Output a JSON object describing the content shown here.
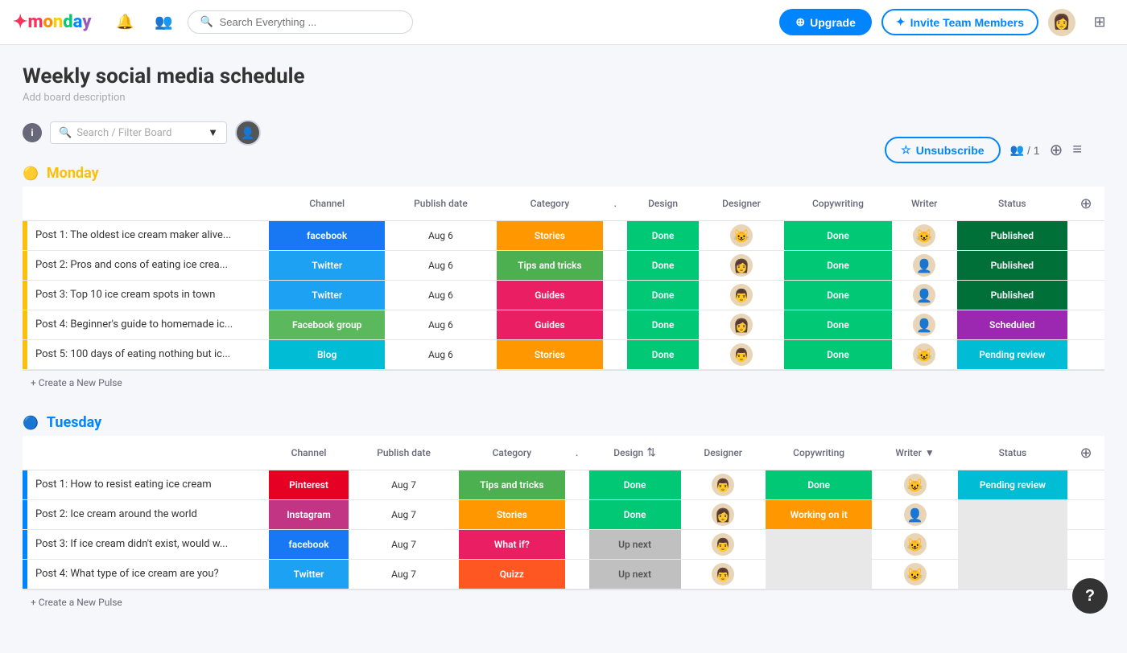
{
  "app": {
    "logo": "monday",
    "nav": {
      "search_placeholder": "Search Everything ...",
      "upgrade_label": "Upgrade",
      "invite_label": "Invite Team Members"
    }
  },
  "page": {
    "title": "Weekly social media schedule",
    "subtitle": "Add board description",
    "unsubscribe_label": "Unsubscribe",
    "members_count": "/ 1"
  },
  "toolbar": {
    "search_placeholder": "Search / Filter Board",
    "create_pulse_label": "+ Create a New Pulse"
  },
  "monday": {
    "day_label": "Monday",
    "columns": {
      "channel": "Channel",
      "publish_date": "Publish date",
      "category": "Category",
      "design": "Design",
      "designer": "Designer",
      "copywriting": "Copywriting",
      "writer": "Writer",
      "status": "Status"
    },
    "rows": [
      {
        "name": "Post 1: The oldest ice cream maker alive...",
        "channel": "facebook",
        "channel_label": "facebook",
        "publish_date": "Aug 6",
        "category": "Stories",
        "design": "Done",
        "copywriting": "Done",
        "status": "Published",
        "avatar_design": "😺",
        "avatar_writer": "😺"
      },
      {
        "name": "Post 2: Pros and cons of eating ice crea...",
        "channel": "twitter",
        "channel_label": "Twitter",
        "publish_date": "Aug 6",
        "category": "Tips and tricks",
        "design": "Done",
        "copywriting": "Done",
        "status": "Published",
        "avatar_design": "👩",
        "avatar_writer": "👤"
      },
      {
        "name": "Post 3: Top 10 ice cream spots in town",
        "channel": "twitter",
        "channel_label": "Twitter",
        "publish_date": "Aug 6",
        "category": "Guides",
        "design": "Done",
        "copywriting": "Done",
        "status": "Published",
        "avatar_design": "👨",
        "avatar_writer": "👤"
      },
      {
        "name": "Post 4: Beginner's guide to homemade ic...",
        "channel": "fbgroup",
        "channel_label": "Facebook group",
        "publish_date": "Aug 6",
        "category": "Guides",
        "design": "Done",
        "copywriting": "Done",
        "status": "Scheduled",
        "avatar_design": "👩",
        "avatar_writer": "👤"
      },
      {
        "name": "Post 5: 100 days of eating nothing but ic...",
        "channel": "blog",
        "channel_label": "Blog",
        "publish_date": "Aug 6",
        "category": "Stories",
        "design": "Done",
        "copywriting": "Done",
        "status": "Pending review",
        "avatar_design": "👨",
        "avatar_writer": "😺"
      }
    ],
    "create_pulse": "+ Create a New Pulse"
  },
  "tuesday": {
    "day_label": "Tuesday",
    "columns": {
      "channel": "Channel",
      "publish_date": "Publish date",
      "category": "Category",
      "design": "Design",
      "designer": "Designer",
      "copywriting": "Copywriting",
      "writer": "Writer",
      "status": "Status"
    },
    "rows": [
      {
        "name": "Post 1: How to resist eating ice cream",
        "channel": "pinterest",
        "channel_label": "Pinterest",
        "publish_date": "Aug 7",
        "category": "Tips and tricks",
        "design": "Done",
        "copywriting": "Done",
        "status": "Pending review",
        "avatar_design": "👨",
        "avatar_writer": "😺"
      },
      {
        "name": "Post 2: Ice cream around the world",
        "channel": "instagram",
        "channel_label": "Instagram",
        "publish_date": "Aug 7",
        "category": "Stories",
        "design": "Done",
        "copywriting": "Working on it",
        "status": "",
        "avatar_design": "👩",
        "avatar_writer": "👤"
      },
      {
        "name": "Post 3: If ice cream didn't exist, would w...",
        "channel": "facebook",
        "channel_label": "facebook",
        "publish_date": "Aug 7",
        "category": "What if?",
        "design": "Up next",
        "copywriting": "",
        "status": "",
        "avatar_design": "👨",
        "avatar_writer": "😺"
      },
      {
        "name": "Post 4: What type of ice cream are you?",
        "channel": "twitter",
        "channel_label": "Twitter",
        "publish_date": "Aug 7",
        "category": "Quizz",
        "design": "Up next",
        "copywriting": "",
        "status": "",
        "avatar_design": "👨",
        "avatar_writer": "😺"
      }
    ],
    "create_pulse": "+ Create a New Pulse"
  }
}
